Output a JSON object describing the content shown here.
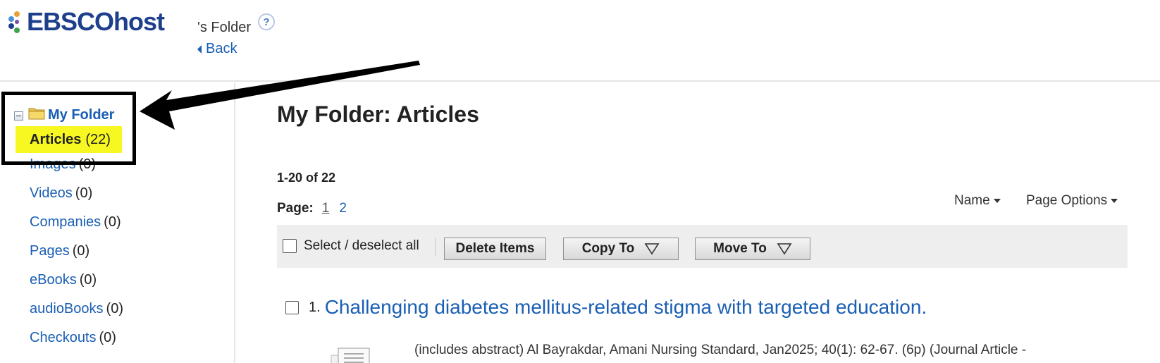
{
  "header": {
    "logo_text": "EBSCOhost",
    "folder_owner": "'s Folder",
    "help_glyph": "?",
    "back_label": "Back"
  },
  "sidebar": {
    "root_label": "My Folder",
    "selected": {
      "label": "Articles",
      "count": "(22)"
    },
    "items": [
      {
        "label": "Images",
        "count": "(0)"
      },
      {
        "label": "Videos",
        "count": "(0)"
      },
      {
        "label": "Companies",
        "count": "(0)"
      },
      {
        "label": "Pages",
        "count": "(0)"
      },
      {
        "label": "eBooks",
        "count": "(0)"
      },
      {
        "label": "audioBooks",
        "count": "(0)"
      },
      {
        "label": "Checkouts",
        "count": "(0)"
      }
    ]
  },
  "main": {
    "title": "My Folder: Articles",
    "result_range": "1-20 of 22",
    "page_label": "Page:",
    "pages": [
      "1",
      "2"
    ],
    "sort_label": "Name",
    "page_options_label": "Page Options",
    "toolbar": {
      "select_all_label": "Select / deselect all",
      "delete_label": "Delete Items",
      "copy_label": "Copy To",
      "move_label": "Move To"
    },
    "results": [
      {
        "number": "1.",
        "title": "Challenging diabetes mellitus-related stigma with targeted education.",
        "meta": "(includes abstract) Al Bayrakdar, Amani Nursing Standard, Jan2025; 40(1): 62-67. (6p) (Journal Article -"
      }
    ]
  },
  "colors": {
    "link": "#1a5fb4",
    "highlight": "#f7f721",
    "logo": "#1d3f8c",
    "toolbar_bg": "#eeeeee"
  },
  "icons": [
    "ebsco-logo-icon",
    "help-icon",
    "back-caret-icon",
    "tree-collapse-icon",
    "folder-icon",
    "dropdown-caret-icon",
    "dropdown-triangle-icon",
    "document-thumbnail-icon",
    "annotation-arrow-icon"
  ]
}
